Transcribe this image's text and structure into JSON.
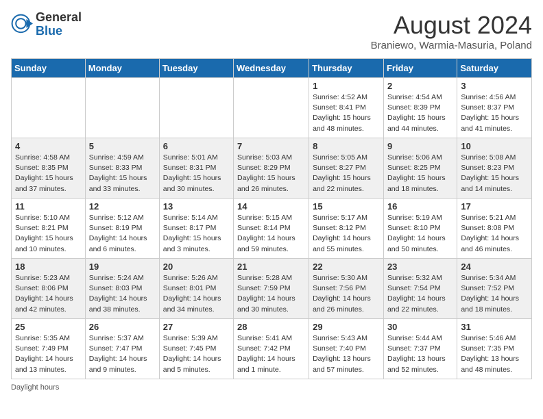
{
  "header": {
    "logo_general": "General",
    "logo_blue": "Blue",
    "month_year": "August 2024",
    "location": "Braniewo, Warmia-Masuria, Poland"
  },
  "weekdays": [
    "Sunday",
    "Monday",
    "Tuesday",
    "Wednesday",
    "Thursday",
    "Friday",
    "Saturday"
  ],
  "footer": {
    "daylight_label": "Daylight hours"
  },
  "weeks": [
    [
      {
        "day": "",
        "info": ""
      },
      {
        "day": "",
        "info": ""
      },
      {
        "day": "",
        "info": ""
      },
      {
        "day": "",
        "info": ""
      },
      {
        "day": "1",
        "info": "Sunrise: 4:52 AM\nSunset: 8:41 PM\nDaylight: 15 hours and 48 minutes."
      },
      {
        "day": "2",
        "info": "Sunrise: 4:54 AM\nSunset: 8:39 PM\nDaylight: 15 hours and 44 minutes."
      },
      {
        "day": "3",
        "info": "Sunrise: 4:56 AM\nSunset: 8:37 PM\nDaylight: 15 hours and 41 minutes."
      }
    ],
    [
      {
        "day": "4",
        "info": "Sunrise: 4:58 AM\nSunset: 8:35 PM\nDaylight: 15 hours and 37 minutes."
      },
      {
        "day": "5",
        "info": "Sunrise: 4:59 AM\nSunset: 8:33 PM\nDaylight: 15 hours and 33 minutes."
      },
      {
        "day": "6",
        "info": "Sunrise: 5:01 AM\nSunset: 8:31 PM\nDaylight: 15 hours and 30 minutes."
      },
      {
        "day": "7",
        "info": "Sunrise: 5:03 AM\nSunset: 8:29 PM\nDaylight: 15 hours and 26 minutes."
      },
      {
        "day": "8",
        "info": "Sunrise: 5:05 AM\nSunset: 8:27 PM\nDaylight: 15 hours and 22 minutes."
      },
      {
        "day": "9",
        "info": "Sunrise: 5:06 AM\nSunset: 8:25 PM\nDaylight: 15 hours and 18 minutes."
      },
      {
        "day": "10",
        "info": "Sunrise: 5:08 AM\nSunset: 8:23 PM\nDaylight: 15 hours and 14 minutes."
      }
    ],
    [
      {
        "day": "11",
        "info": "Sunrise: 5:10 AM\nSunset: 8:21 PM\nDaylight: 15 hours and 10 minutes."
      },
      {
        "day": "12",
        "info": "Sunrise: 5:12 AM\nSunset: 8:19 PM\nDaylight: 14 hours and 6 minutes."
      },
      {
        "day": "13",
        "info": "Sunrise: 5:14 AM\nSunset: 8:17 PM\nDaylight: 15 hours and 3 minutes."
      },
      {
        "day": "14",
        "info": "Sunrise: 5:15 AM\nSunset: 8:14 PM\nDaylight: 14 hours and 59 minutes."
      },
      {
        "day": "15",
        "info": "Sunrise: 5:17 AM\nSunset: 8:12 PM\nDaylight: 14 hours and 55 minutes."
      },
      {
        "day": "16",
        "info": "Sunrise: 5:19 AM\nSunset: 8:10 PM\nDaylight: 14 hours and 50 minutes."
      },
      {
        "day": "17",
        "info": "Sunrise: 5:21 AM\nSunset: 8:08 PM\nDaylight: 14 hours and 46 minutes."
      }
    ],
    [
      {
        "day": "18",
        "info": "Sunrise: 5:23 AM\nSunset: 8:06 PM\nDaylight: 14 hours and 42 minutes."
      },
      {
        "day": "19",
        "info": "Sunrise: 5:24 AM\nSunset: 8:03 PM\nDaylight: 14 hours and 38 minutes."
      },
      {
        "day": "20",
        "info": "Sunrise: 5:26 AM\nSunset: 8:01 PM\nDaylight: 14 hours and 34 minutes."
      },
      {
        "day": "21",
        "info": "Sunrise: 5:28 AM\nSunset: 7:59 PM\nDaylight: 14 hours and 30 minutes."
      },
      {
        "day": "22",
        "info": "Sunrise: 5:30 AM\nSunset: 7:56 PM\nDaylight: 14 hours and 26 minutes."
      },
      {
        "day": "23",
        "info": "Sunrise: 5:32 AM\nSunset: 7:54 PM\nDaylight: 14 hours and 22 minutes."
      },
      {
        "day": "24",
        "info": "Sunrise: 5:34 AM\nSunset: 7:52 PM\nDaylight: 14 hours and 18 minutes."
      }
    ],
    [
      {
        "day": "25",
        "info": "Sunrise: 5:35 AM\nSunset: 7:49 PM\nDaylight: 14 hours and 13 minutes."
      },
      {
        "day": "26",
        "info": "Sunrise: 5:37 AM\nSunset: 7:47 PM\nDaylight: 14 hours and 9 minutes."
      },
      {
        "day": "27",
        "info": "Sunrise: 5:39 AM\nSunset: 7:45 PM\nDaylight: 14 hours and 5 minutes."
      },
      {
        "day": "28",
        "info": "Sunrise: 5:41 AM\nSunset: 7:42 PM\nDaylight: 14 hours and 1 minute."
      },
      {
        "day": "29",
        "info": "Sunrise: 5:43 AM\nSunset: 7:40 PM\nDaylight: 13 hours and 57 minutes."
      },
      {
        "day": "30",
        "info": "Sunrise: 5:44 AM\nSunset: 7:37 PM\nDaylight: 13 hours and 52 minutes."
      },
      {
        "day": "31",
        "info": "Sunrise: 5:46 AM\nSunset: 7:35 PM\nDaylight: 13 hours and 48 minutes."
      }
    ]
  ]
}
